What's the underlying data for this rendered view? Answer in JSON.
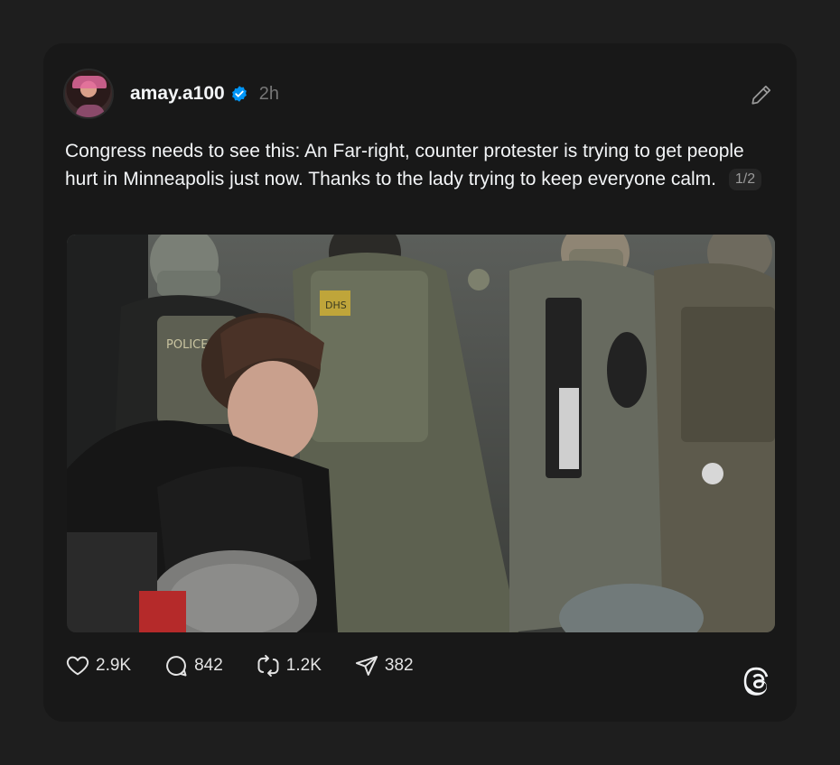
{
  "post": {
    "username": "amay.a100",
    "verified": true,
    "time": "2h",
    "text": "Congress needs to see this: An Far-right, counter protester is trying to get people hurt in Minneapolis just now. Thanks to the lady trying to keep everyone calm.",
    "page_indicator": "1/2"
  },
  "media": {
    "patch_text_1": "POLICE",
    "patch_text_2": "DHS"
  },
  "actions": {
    "likes": "2.9K",
    "replies": "842",
    "reposts": "1.2K",
    "shares": "382"
  },
  "colors": {
    "background": "#1e1e1e",
    "card": "#181818",
    "verified_blue": "#0095f6",
    "text_primary": "#f3f5f7",
    "text_secondary": "#777777"
  },
  "icons": {
    "verified": "verified-badge-icon",
    "edit": "pencil-icon",
    "like": "heart-icon",
    "reply": "comment-icon",
    "repost": "repost-icon",
    "share": "send-icon",
    "brand": "threads-logo-icon"
  }
}
